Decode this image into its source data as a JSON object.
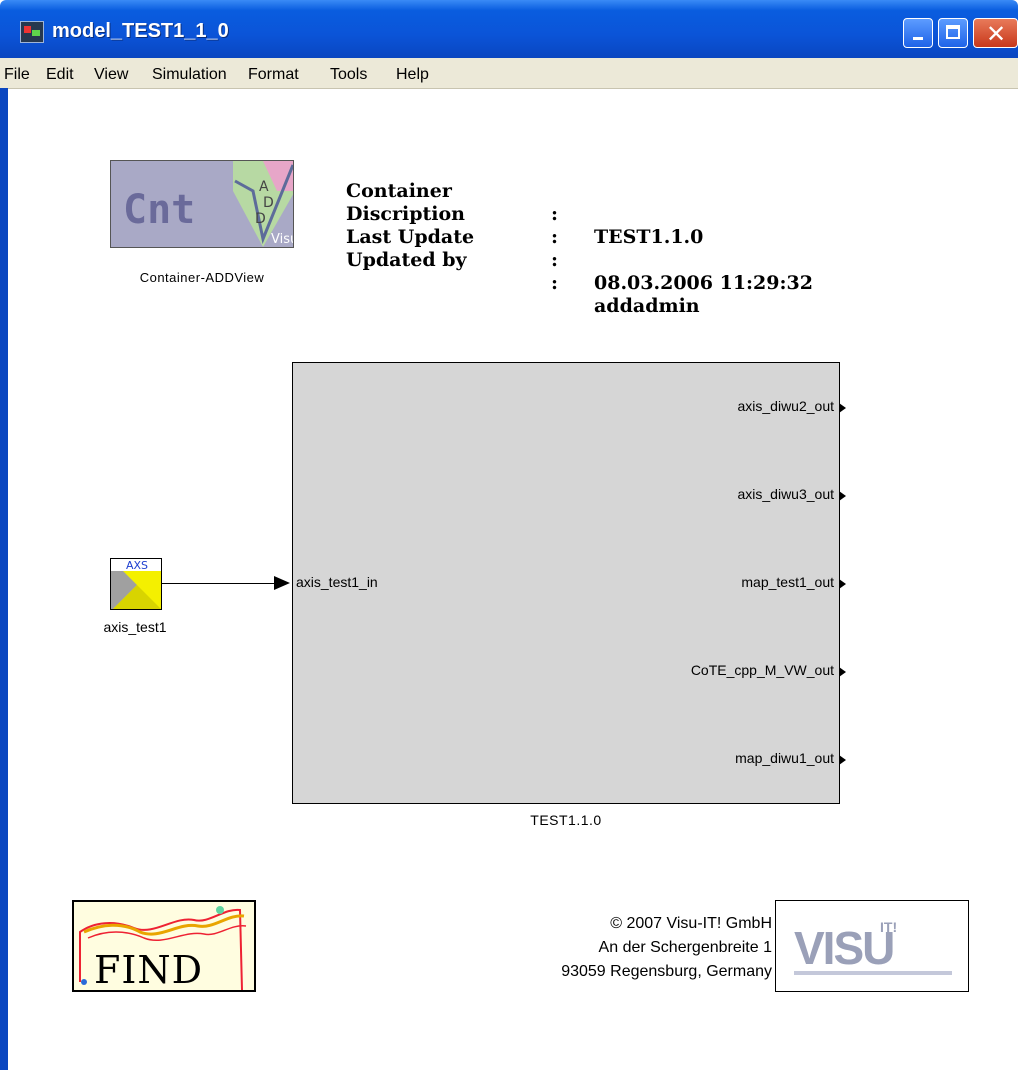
{
  "window": {
    "title": "model_TEST1_1_0"
  },
  "menu": [
    "File",
    "Edit",
    "View",
    "Simulation",
    "Format",
    "Tools",
    "Help"
  ],
  "container_logo": {
    "text": "Cnt",
    "caption": "Container-ADDView"
  },
  "info": {
    "rows": [
      {
        "label": "Container",
        "colon": ":",
        "value": "TEST1.1.0"
      },
      {
        "label": "Discription",
        "colon": ":",
        "value": ""
      },
      {
        "label": "Last Update",
        "colon": ":",
        "value": "08.03.2006 11:29:32"
      },
      {
        "label": "Updated by",
        "colon": ":",
        "value": "addadmin"
      }
    ]
  },
  "main_block": {
    "caption": "TEST1.1.0",
    "input_port": "axis_test1_in",
    "output_ports": [
      "axis_diwu2_out",
      "axis_diwu3_out",
      "map_test1_out",
      "CoTE_cpp_M_VW_out",
      "map_diwu1_out"
    ]
  },
  "axis_block": {
    "icon_text": "AXS",
    "caption": "axis_test1"
  },
  "find_logo": {
    "text": "FIND"
  },
  "copyright": {
    "line1": "© 2007 Visu-IT! GmbH",
    "line2": "An der Schergenbreite 1",
    "line3": "93059 Regensburg, Germany"
  },
  "visu_logo": {
    "text": "VISU",
    "suffix": "IT!"
  }
}
